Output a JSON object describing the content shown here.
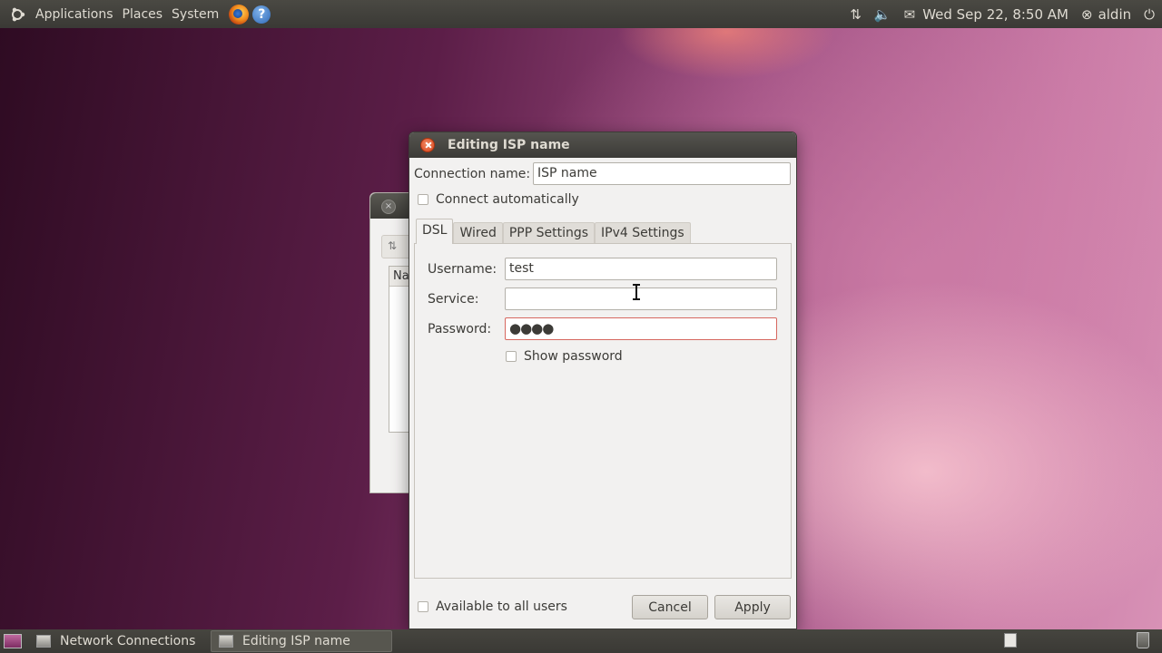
{
  "top_panel": {
    "menus": [
      "Applications",
      "Places",
      "System"
    ],
    "clock": "Wed Sep 22,  8:50 AM",
    "user": "aldin"
  },
  "background_window": {
    "list_header": "Na"
  },
  "dialog": {
    "title": "Editing ISP name",
    "connection_name_label": "Connection name:",
    "connection_name_value": "ISP name",
    "connect_auto_label": "Connect automatically",
    "tabs": [
      "DSL",
      "Wired",
      "PPP Settings",
      "IPv4 Settings"
    ],
    "active_tab": "DSL",
    "dsl": {
      "username_label": "Username:",
      "username_value": "test",
      "service_label": "Service:",
      "service_value": "",
      "password_label": "Password:",
      "password_value": "●●●●",
      "show_password_label": "Show password"
    },
    "available_all_users_label": "Available to all users",
    "cancel_label": "Cancel",
    "apply_label": "Apply"
  },
  "taskbar": {
    "tasks": [
      "Network Connections",
      "Editing ISP name"
    ],
    "active_task": "Editing ISP name"
  },
  "colors": {
    "panel": "#3c3b37",
    "close_button": "#d9431a",
    "dialog_bg": "#f2f1f0",
    "error_border": "#d6675f"
  }
}
